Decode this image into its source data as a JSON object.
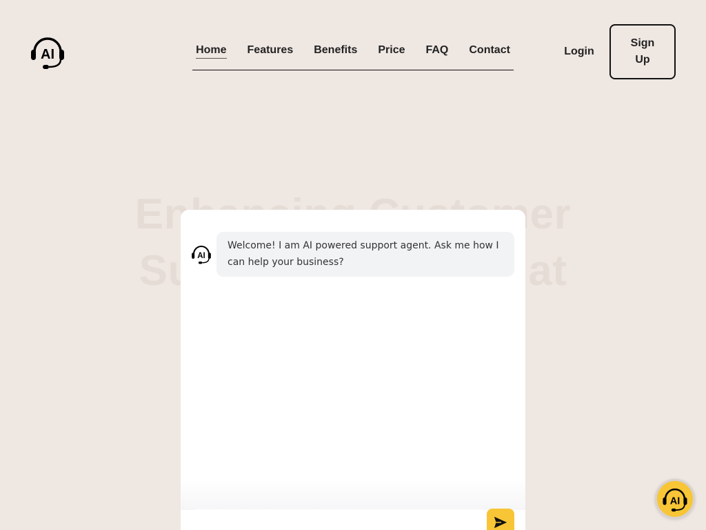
{
  "brand": {
    "logo_text": "AI",
    "logo_icon": "headset-ai-icon"
  },
  "nav": {
    "items": [
      {
        "label": "Home",
        "active": true
      },
      {
        "label": "Features",
        "active": false
      },
      {
        "label": "Benefits",
        "active": false
      },
      {
        "label": "Price",
        "active": false
      },
      {
        "label": "FAQ",
        "active": false
      },
      {
        "label": "Contact",
        "active": false
      }
    ]
  },
  "auth": {
    "login_label": "Login",
    "signup_label": "Sign Up"
  },
  "hero": {
    "title": "Enhancing Customer Support with AI Chat"
  },
  "chat": {
    "bot_icon": "headset-ai-icon",
    "messages": [
      {
        "from": "bot",
        "text": "Welcome! I am AI powered support agent. Ask me how I can help your business?"
      }
    ],
    "input_value": "",
    "input_placeholder": "",
    "send_icon": "send-icon"
  },
  "launcher": {
    "icon": "headset-ai-icon"
  },
  "colors": {
    "background": "#efe7e2",
    "accent": "#f7c536",
    "text": "#1a1a1a",
    "bubble": "#f2f3f5"
  }
}
